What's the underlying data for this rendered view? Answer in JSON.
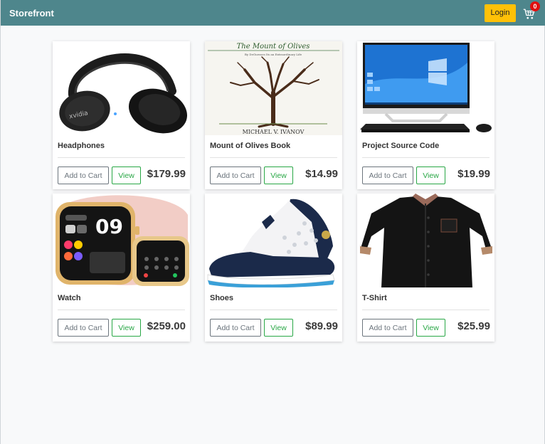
{
  "navbar": {
    "brand": "Storefront",
    "login_label": "Login",
    "cart_icon": "cart-icon",
    "cart_count": "0"
  },
  "colors": {
    "navbar_bg": "#4e868c",
    "login_bg": "#ffc107",
    "badge_bg": "#e01010",
    "view_green": "#28a745",
    "cart_gray": "#6c757d"
  },
  "products": [
    {
      "title": "Headphones",
      "price": "$179.99",
      "add_label": "Add to Cart",
      "view_label": "View",
      "image": "headphones-image"
    },
    {
      "title": "Mount of Olives Book",
      "price": "$14.99",
      "add_label": "Add to Cart",
      "view_label": "View",
      "image": "book-cover-image",
      "cover_title": "The Mount of Olives",
      "cover_subtitle": "By DeGuesses Its an Extraordinary Life",
      "cover_author": "MICHAEL V. IVANOV"
    },
    {
      "title": "Project Source Code",
      "price": "$19.99",
      "add_label": "Add to Cart",
      "view_label": "View",
      "image": "desktop-computer-image"
    },
    {
      "title": "Watch",
      "price": "$259.00",
      "add_label": "Add to Cart",
      "view_label": "View",
      "image": "smartwatch-image",
      "watch_time": "09"
    },
    {
      "title": "Shoes",
      "price": "$89.99",
      "add_label": "Add to Cart",
      "view_label": "View",
      "image": "sneaker-image"
    },
    {
      "title": "T-Shirt",
      "price": "$25.99",
      "add_label": "Add to Cart",
      "view_label": "View",
      "image": "shirt-image"
    }
  ]
}
